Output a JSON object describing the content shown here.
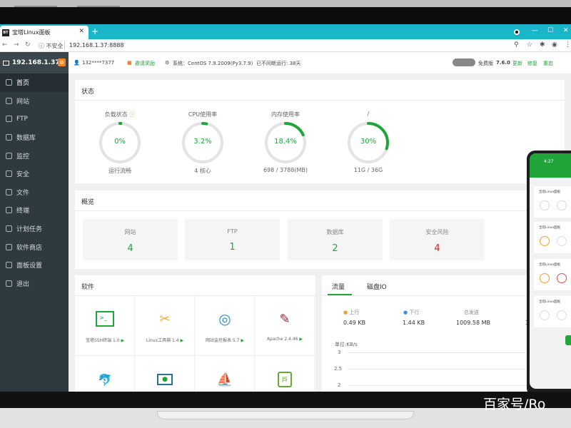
{
  "browser": {
    "tab_title": "宝塔Linux面板",
    "tab_icon": "BT",
    "info_label": "不安全",
    "url": "192.168.1.37:8888"
  },
  "sidebar": {
    "server": "192.168.1.37",
    "badge": "0",
    "items": [
      {
        "label": "首页",
        "icon": "home-icon"
      },
      {
        "label": "网站",
        "icon": "globe-icon"
      },
      {
        "label": "FTP",
        "icon": "ftp-icon"
      },
      {
        "label": "数据库",
        "icon": "database-icon"
      },
      {
        "label": "监控",
        "icon": "monitor-icon"
      },
      {
        "label": "安全",
        "icon": "shield-icon"
      },
      {
        "label": "文件",
        "icon": "folder-icon"
      },
      {
        "label": "终端",
        "icon": "terminal-icon"
      },
      {
        "label": "计划任务",
        "icon": "calendar-icon"
      },
      {
        "label": "软件商店",
        "icon": "store-icon"
      },
      {
        "label": "面板设置",
        "icon": "settings-icon"
      },
      {
        "label": "退出",
        "icon": "logout-icon"
      }
    ]
  },
  "topinfo": {
    "user": "132****7377",
    "invite": "邀请奖励",
    "system": "系统：CentOS 7.9.2009(Py3.7.9)",
    "uptime": "已不间断运行: 38天",
    "plan": "免费版",
    "version": "7.6.0",
    "update": "更新",
    "repair": "修复",
    "restart": "重启"
  },
  "status": {
    "title": "状态",
    "gauges": [
      {
        "label": "负载状态",
        "value": "0%",
        "sub": "运行流畅",
        "percent": 0
      },
      {
        "label": "CPU使用率",
        "value": "3.2%",
        "sub": "4 核心",
        "percent": 3.2
      },
      {
        "label": "内存使用率",
        "value": "18.4%",
        "sub": "698 / 3788(MB)",
        "percent": 18.4
      },
      {
        "label": "/",
        "value": "30%",
        "sub": "11G / 36G",
        "percent": 30
      }
    ]
  },
  "overview": {
    "title": "概览",
    "items": [
      {
        "label": "网站",
        "value": "4",
        "color": "#20a53a"
      },
      {
        "label": "FTP",
        "value": "1",
        "color": "#20a53a"
      },
      {
        "label": "数据库",
        "value": "2",
        "color": "#20a53a"
      },
      {
        "label": "安全风险",
        "value": "4",
        "color": "#e02020"
      }
    ]
  },
  "software": {
    "title": "软件",
    "items": [
      {
        "name": "宝塔SSH终端 1.0",
        "icon": "terminal-icon"
      },
      {
        "name": "Linux工具箱 1.4",
        "icon": "tools-icon"
      },
      {
        "name": "网站监控报表 5.7",
        "icon": "target-icon"
      },
      {
        "name": "Apache 2.4.46",
        "icon": "feather-icon"
      },
      {
        "name": "",
        "icon": "mysql-icon"
      },
      {
        "name": "",
        "icon": "person-screen-icon"
      },
      {
        "name": "",
        "icon": "ship-icon"
      },
      {
        "name": "",
        "icon": "nodejs-icon"
      }
    ]
  },
  "traffic": {
    "tabs": [
      "流量",
      "磁盘IO"
    ],
    "stats": [
      {
        "label": "上行",
        "value": "0.49 KB"
      },
      {
        "label": "下行",
        "value": "1.44 KB"
      },
      {
        "label": "总发送",
        "value": "1009.58 MB"
      }
    ],
    "unit": "单位:KB/s",
    "yticks": [
      "3",
      "2.5",
      "2"
    ],
    "truncated_value": "3"
  },
  "phone": {
    "time": "4:27",
    "card_title": "宝塔Linux面板"
  },
  "watermark": "百家号/Ro",
  "colors": {
    "accent": "#20a53a",
    "danger": "#e02020",
    "sidebar": "#2f3a3f",
    "browser": "#1bb5c9"
  }
}
